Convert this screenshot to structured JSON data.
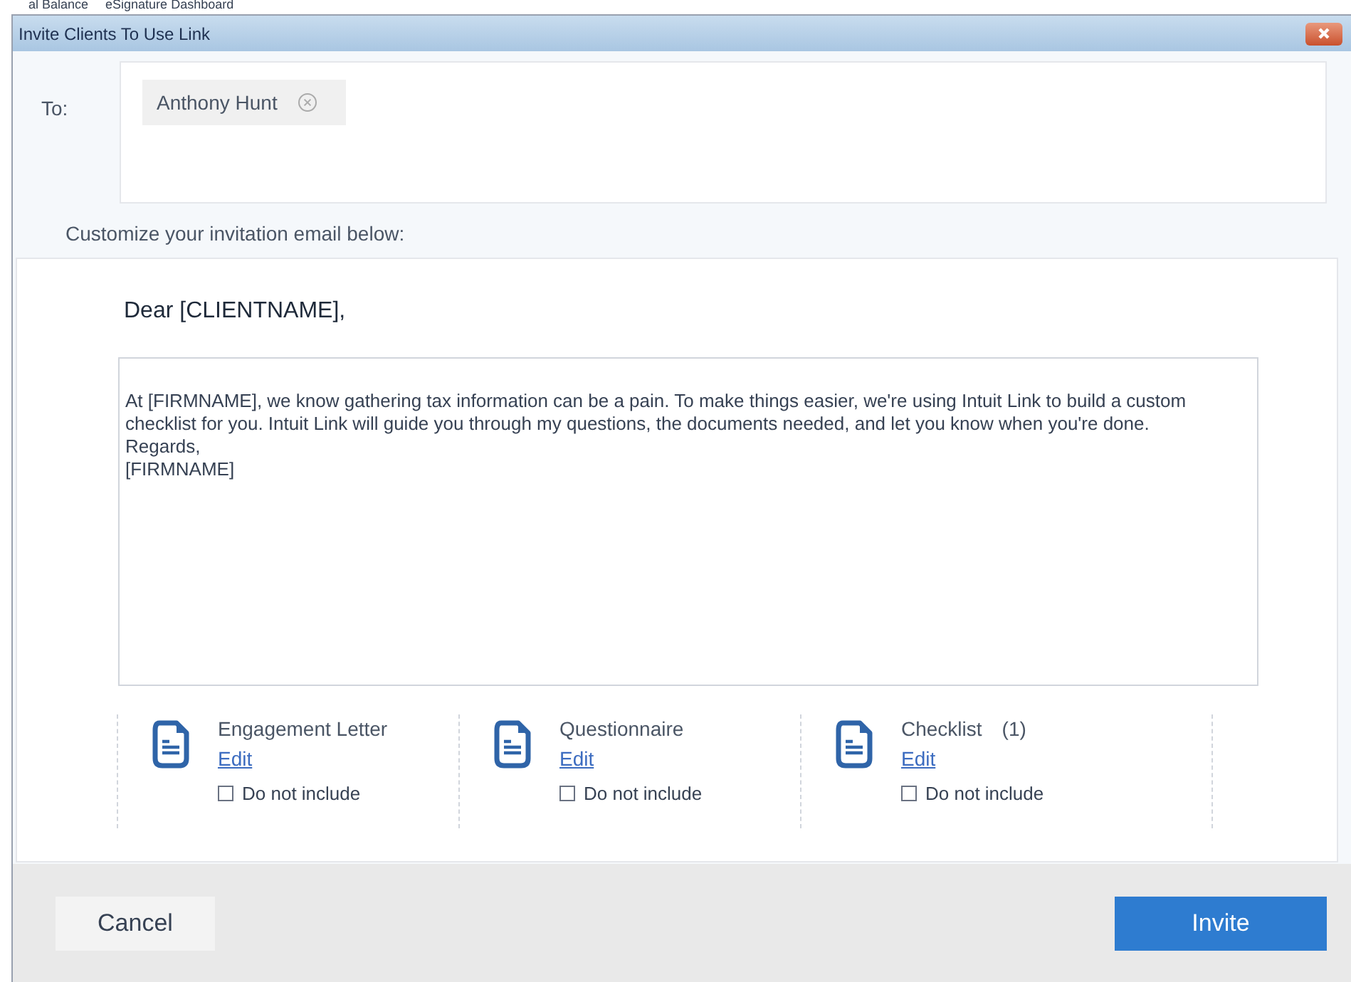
{
  "breadcrumb": [
    "al Balance",
    "eSignature Dashboard"
  ],
  "window": {
    "title": "Invite Clients To Use Link"
  },
  "to": {
    "label": "To:",
    "recipients": [
      {
        "name": "Anthony Hunt"
      }
    ]
  },
  "customize_label": "Customize your invitation email below:",
  "email": {
    "greeting": "Dear [CLIENTNAME],",
    "body": [
      "At [FIRMNAME], we know gathering tax information can be a pain. To make things easier, we're using Intuit Link to build a custom checklist for you. Intuit Link will guide you through my questions, the documents needed, and let you know when you're done.",
      "Regards,",
      "[FIRMNAME]"
    ]
  },
  "documents": [
    {
      "title": "Engagement Letter",
      "edit": "Edit",
      "option": "Do not include",
      "checked": false
    },
    {
      "title": "Questionnaire",
      "edit": "Edit",
      "option": "Do not include",
      "checked": false
    },
    {
      "title": "Checklist",
      "count": "(1)",
      "edit": "Edit",
      "option": "Do not include",
      "checked": false
    }
  ],
  "buttons": {
    "cancel": "Cancel",
    "invite": "Invite"
  }
}
